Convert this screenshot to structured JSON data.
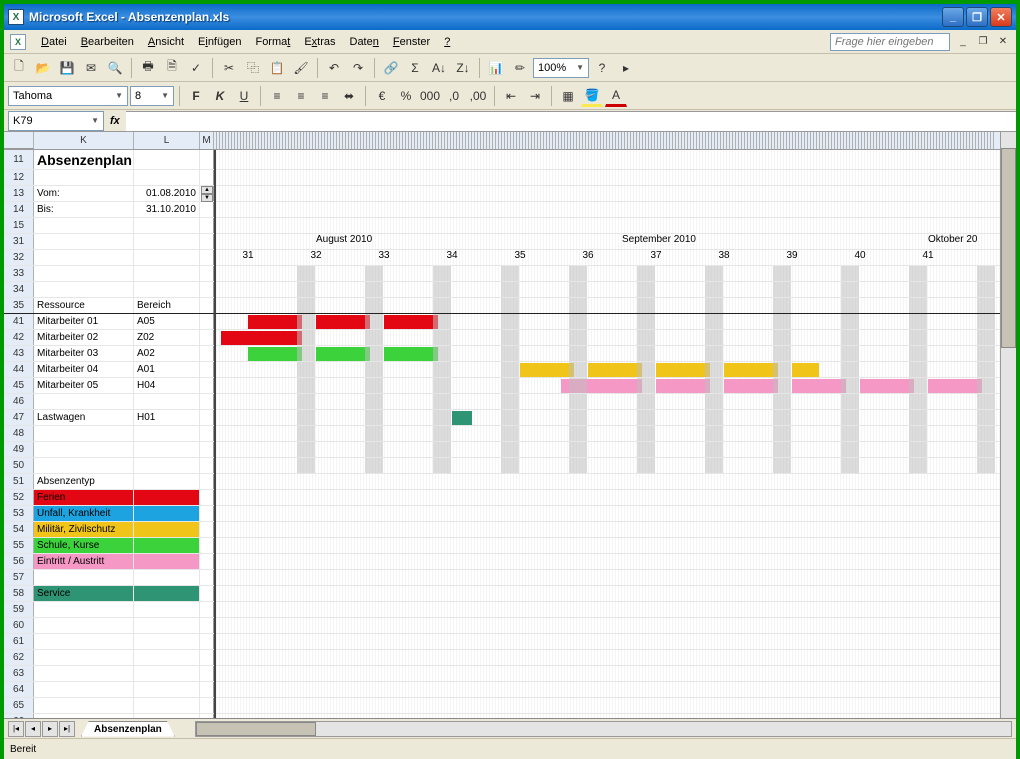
{
  "app": {
    "title": "Microsoft Excel - Absenzenplan.xls"
  },
  "menu": {
    "datei": "Datei",
    "bearbeiten": "Bearbeiten",
    "ansicht": "Ansicht",
    "einfuegen": "Einfügen",
    "format": "Format",
    "extras": "Extras",
    "daten": "Daten",
    "fenster": "Fenster",
    "hilfe": "?"
  },
  "help_placeholder": "Frage hier eingeben",
  "format_bar": {
    "font": "Tahoma",
    "size": "8"
  },
  "toolbar": {
    "zoom": "100%"
  },
  "namebox": "K79",
  "sheet_title": "Absenzenplan",
  "dates": {
    "vom_label": "Vom:",
    "vom": "01.08.2010",
    "bis_label": "Bis:",
    "bis": "31.10.2010"
  },
  "months": {
    "aug": "August 2010",
    "sep": "September 2010",
    "okt": "Oktober 20"
  },
  "weeks": [
    "31",
    "32",
    "33",
    "34",
    "35",
    "36",
    "37",
    "38",
    "39",
    "40",
    "41"
  ],
  "headers": {
    "ressource": "Ressource",
    "bereich": "Bereich"
  },
  "resources": [
    {
      "name": "Mitarbeiter 01",
      "bereich": "A05"
    },
    {
      "name": "Mitarbeiter 02",
      "bereich": "Z02"
    },
    {
      "name": "Mitarbeiter 03",
      "bereich": "A02"
    },
    {
      "name": "Mitarbeiter 04",
      "bereich": "A01"
    },
    {
      "name": "Mitarbeiter 05",
      "bereich": "H04"
    },
    {
      "name": "",
      "bereich": ""
    },
    {
      "name": "Lastwagen",
      "bereich": "H01"
    }
  ],
  "legend_header": "Absenzentyp",
  "legend": [
    {
      "label": "Ferien",
      "color": "#e30613"
    },
    {
      "label": "Unfall, Krankheit",
      "color": "#1ca3e0"
    },
    {
      "label": "Militär, Zivilschutz",
      "color": "#f0c418"
    },
    {
      "label": "Schule, Kurse",
      "color": "#3bd23b"
    },
    {
      "label": "Eintritt / Austritt",
      "color": "#f598c6"
    },
    {
      "label": "",
      "color": ""
    },
    {
      "label": "Service",
      "color": "#2f9474"
    }
  ],
  "tab": "Absenzenplan",
  "status": "Bereit",
  "chart_data": {
    "type": "gantt",
    "x_unit": "week",
    "x_range": [
      31,
      41
    ],
    "series": [
      {
        "resource": "Mitarbeiter 01",
        "segments": [
          {
            "start": 31,
            "end": 31.8,
            "type": "Ferien",
            "color": "#e30613"
          },
          {
            "start": 32,
            "end": 32.8,
            "type": "Ferien",
            "color": "#e30613"
          },
          {
            "start": 33,
            "end": 33.8,
            "type": "Ferien",
            "color": "#e30613"
          }
        ]
      },
      {
        "resource": "Mitarbeiter 02",
        "segments": [
          {
            "start": 30.6,
            "end": 31.8,
            "type": "Ferien",
            "color": "#e30613"
          }
        ]
      },
      {
        "resource": "Mitarbeiter 03",
        "segments": [
          {
            "start": 31,
            "end": 31.8,
            "type": "Schule, Kurse",
            "color": "#3bd23b"
          },
          {
            "start": 32,
            "end": 32.8,
            "type": "Schule, Kurse",
            "color": "#3bd23b"
          },
          {
            "start": 33,
            "end": 33.8,
            "type": "Schule, Kurse",
            "color": "#3bd23b"
          }
        ]
      },
      {
        "resource": "Mitarbeiter 04",
        "segments": [
          {
            "start": 35,
            "end": 35.8,
            "type": "Militär",
            "color": "#f0c418"
          },
          {
            "start": 36,
            "end": 36.8,
            "type": "Militär",
            "color": "#f0c418"
          },
          {
            "start": 37,
            "end": 37.8,
            "type": "Militär",
            "color": "#f0c418"
          },
          {
            "start": 38,
            "end": 38.8,
            "type": "Militär",
            "color": "#f0c418"
          },
          {
            "start": 39,
            "end": 39.4,
            "type": "Militär",
            "color": "#f0c418"
          }
        ]
      },
      {
        "resource": "Mitarbeiter 05",
        "segments": [
          {
            "start": 35.6,
            "end": 36.8,
            "type": "Eintritt / Austritt",
            "color": "#f598c6"
          },
          {
            "start": 37,
            "end": 37.8,
            "type": "Eintritt / Austritt",
            "color": "#f598c6"
          },
          {
            "start": 38,
            "end": 38.8,
            "type": "Eintritt / Austritt",
            "color": "#f598c6"
          },
          {
            "start": 39,
            "end": 39.8,
            "type": "Eintritt / Austritt",
            "color": "#f598c6"
          },
          {
            "start": 40,
            "end": 40.8,
            "type": "Eintritt / Austritt",
            "color": "#f598c6"
          },
          {
            "start": 41,
            "end": 41.8,
            "type": "Eintritt / Austritt",
            "color": "#f598c6"
          }
        ]
      },
      {
        "resource": "Lastwagen",
        "segments": [
          {
            "start": 34,
            "end": 34.3,
            "type": "Service",
            "color": "#2f9474"
          }
        ]
      }
    ]
  }
}
